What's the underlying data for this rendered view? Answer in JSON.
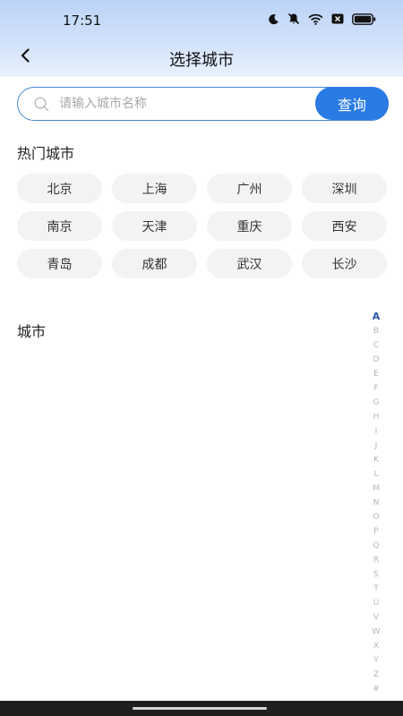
{
  "status_bar": {
    "time": "17:51",
    "icons": [
      "moon-icon",
      "bell-muted-icon",
      "wifi-icon",
      "sim-off-icon",
      "battery-icon"
    ]
  },
  "nav": {
    "title": "选择城市",
    "back_icon": "chevron-left-icon"
  },
  "search": {
    "placeholder": "请输入城市名称",
    "value": "",
    "button_label": "查询"
  },
  "hot_cities": {
    "title": "热门城市",
    "items": [
      "北京",
      "上海",
      "广州",
      "深圳",
      "南京",
      "天津",
      "重庆",
      "西安",
      "青岛",
      "成都",
      "武汉",
      "长沙"
    ]
  },
  "city_list": {
    "title": "城市"
  },
  "index_bar": {
    "active": "A",
    "letters": [
      "A",
      "B",
      "C",
      "D",
      "E",
      "F",
      "G",
      "H",
      "I",
      "J",
      "K",
      "L",
      "M",
      "N",
      "O",
      "P",
      "Q",
      "R",
      "S",
      "T",
      "U",
      "V",
      "W",
      "X",
      "Y",
      "Z",
      "#"
    ]
  },
  "colors": {
    "accent": "#2b7be4",
    "search_border": "#4b84d6",
    "index_active": "#2a54a8",
    "chip_bg": "#f3f3f3"
  }
}
